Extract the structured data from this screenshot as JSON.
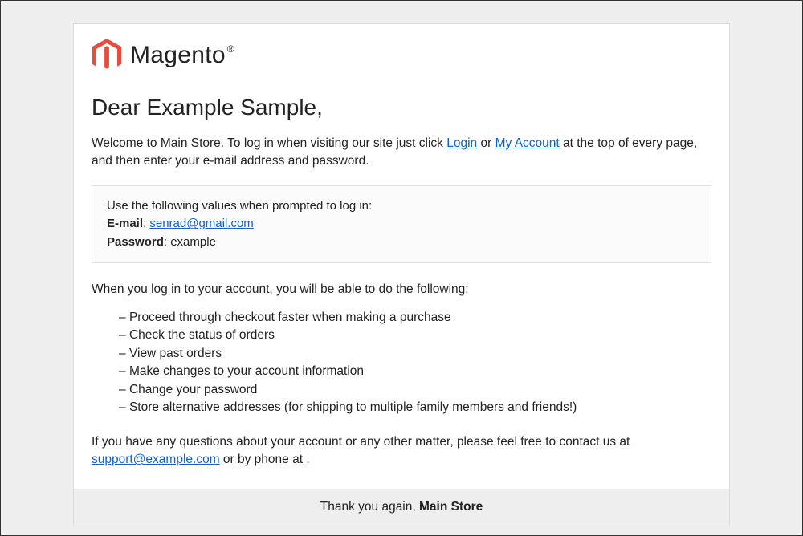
{
  "logo": {
    "brand_text": "Magento"
  },
  "greeting": "Dear Example Sample,",
  "welcome": {
    "pre": "Welcome to Main Store. To log in when visiting our site just click ",
    "login_link": "Login",
    "mid": " or ",
    "account_link": "My Account",
    "post": " at the top of every page, and then enter your e-mail address and password."
  },
  "credentials": {
    "instruction": "Use the following values when prompted to log in:",
    "email_label": "E-mail",
    "email_value": "senrad@gmail.com",
    "password_label": "Password",
    "password_value": "example"
  },
  "features_intro": "When you log in to your account, you will be able to do the following:",
  "features": [
    "Proceed through checkout faster when making a purchase",
    "Check the status of orders",
    "View past orders",
    "Make changes to your account information",
    "Change your password",
    "Store alternative addresses (for shipping to multiple family members and friends!)"
  ],
  "contact": {
    "pre": "If you have any questions about your account or any other matter, please feel free to contact us at ",
    "support_link": "support@example.com",
    "post": " or by phone at ."
  },
  "footer": {
    "thanks": "Thank you again, ",
    "store": "Main Store"
  },
  "colors": {
    "accent": "#e74c3c",
    "link": "#1062c9"
  }
}
